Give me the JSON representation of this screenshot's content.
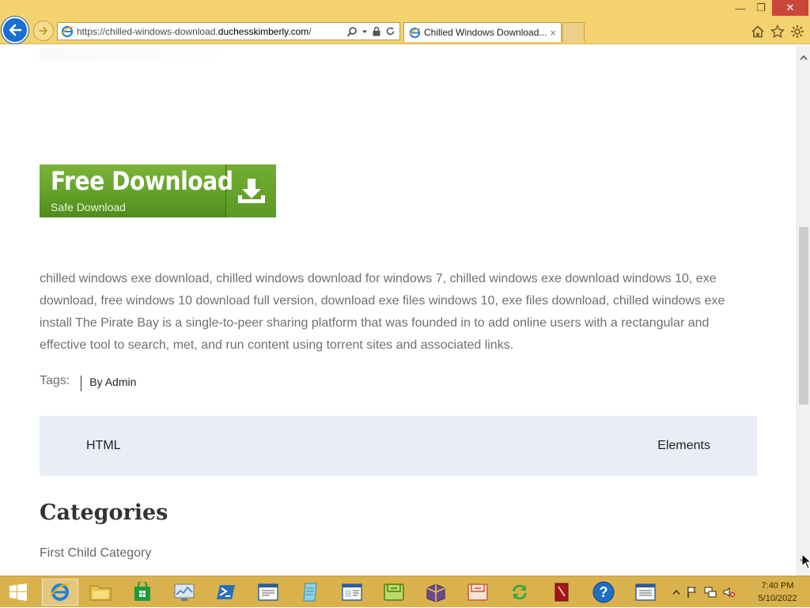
{
  "browser": {
    "url_prefix": "https://chilled-windows-download.",
    "url_domain": "duchesskimberly.com",
    "url_suffix": "/",
    "tab_title": "Chilled Windows Download...",
    "tab_close": "×",
    "window_controls": {
      "minimize": "—",
      "restore": "❐",
      "close": "✕"
    }
  },
  "page": {
    "download_button": {
      "title": "Free Download",
      "subtitle": "Safe Download"
    },
    "description": "chilled windows exe download, chilled windows download for windows 7, chilled windows exe download windows 10, exe download, free windows 10 download full version, download exe files windows 10, exe files download, chilled windows exe install The Pirate Bay is a single-to-peer sharing platform that was founded in to add online users with a rectangular and effective tool to search, met, and run content using torrent sites and associated links.",
    "tags_label": "Tags:",
    "author": "By Admin",
    "post_nav": {
      "previous": "HTML",
      "next": "Elements"
    },
    "categories_heading": "Categories",
    "first_category": "First Child Category"
  },
  "taskbar": {
    "items": [
      "start",
      "internet-explorer",
      "file-explorer",
      "store",
      "task-manager",
      "powershell",
      "document",
      "notepad",
      "window-app",
      "green-app",
      "archive-app",
      "orange-app",
      "sync-app",
      "pdf-reader",
      "help",
      "blank-window"
    ],
    "clock_time": "7:40 PM",
    "clock_date": "5/10/2022"
  },
  "colors": {
    "chrome": "#f3d26f",
    "taskbar": "#d9b24e",
    "download_green": "#63a12a",
    "post_nav_bg": "#e9eef6",
    "back_button": "#1a6fd1"
  }
}
